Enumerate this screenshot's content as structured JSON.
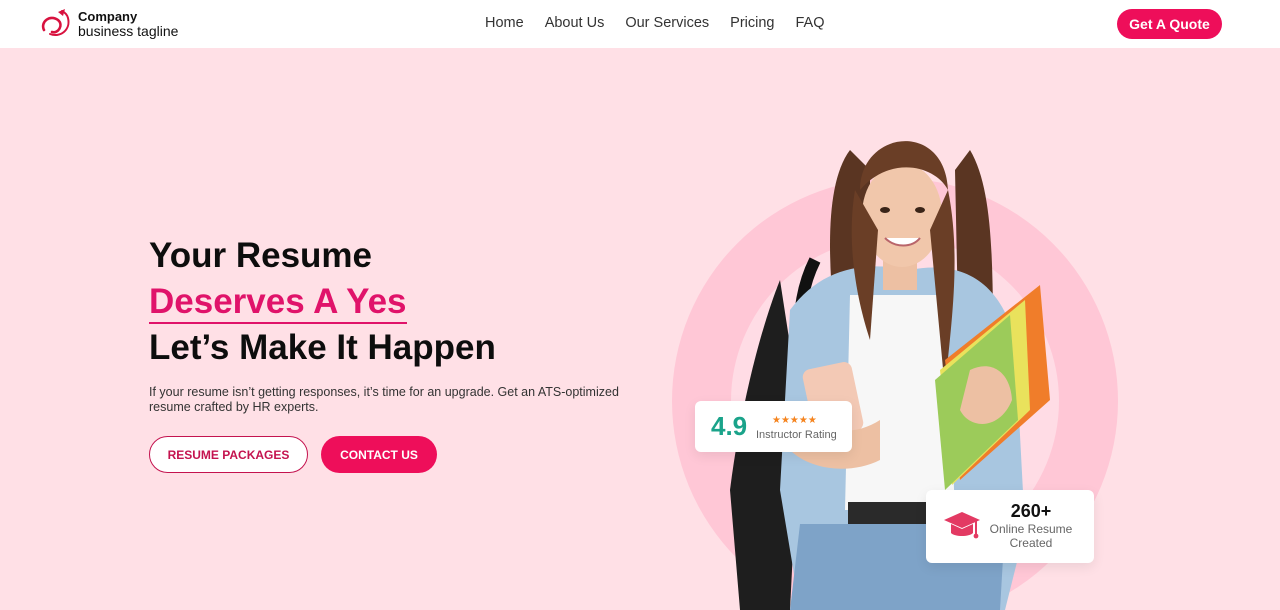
{
  "brand": {
    "name": "Company",
    "tagline": "business tagline",
    "logo_icon": "swirl-logo-icon",
    "accent_color": "#ee0e5a"
  },
  "nav": {
    "links": [
      "Home",
      "About Us",
      "Our Services",
      "Pricing",
      "FAQ"
    ],
    "cta": "Get A Quote"
  },
  "hero": {
    "line1": "Your Resume",
    "line2": "Deserves A Yes",
    "line3": "Let’s Make It Happen",
    "description": "If your resume isn’t getting responses, it’s time for an upgrade. Get an ATS-optimized resume crafted by HR experts.",
    "primary_button": "RESUME PACKAGES",
    "secondary_button": "CONTACT US"
  },
  "rating_card": {
    "value": "4.9",
    "stars": "★★★★★",
    "label": "Instructor Rating"
  },
  "count_card": {
    "value": "260+",
    "label": "Online Resume Created",
    "icon": "graduation-cap-icon"
  }
}
